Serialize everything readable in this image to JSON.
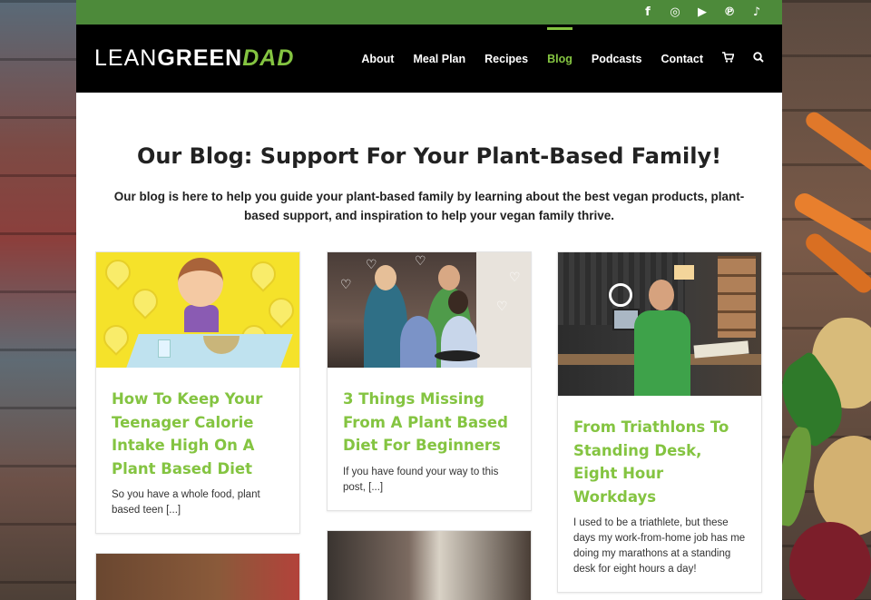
{
  "social": {
    "icons": [
      {
        "name": "facebook-icon",
        "glyph": "f"
      },
      {
        "name": "instagram-icon",
        "glyph": "◎"
      },
      {
        "name": "youtube-icon",
        "glyph": "▶"
      },
      {
        "name": "pinterest-icon",
        "glyph": "℗"
      },
      {
        "name": "tiktok-icon",
        "glyph": "♪"
      }
    ]
  },
  "logo": {
    "part1": "LEAN",
    "part2": "GREEN",
    "part3": "DAD"
  },
  "nav": {
    "items": [
      "About",
      "Meal Plan",
      "Recipes",
      "Blog",
      "Podcasts",
      "Contact"
    ],
    "active": "Blog",
    "cart_icon": "cart-icon",
    "search_icon": "search-icon"
  },
  "page": {
    "title": "Our Blog: Support For Your Plant-Based Family!",
    "intro": "Our blog is here to help you guide your plant-based family by learning about the best vegan products, plant-based support, and inspiration to help your vegan family thrive."
  },
  "posts": [
    {
      "title": "How To Keep Your Teenager Calorie Intake High On A Plant Based Diet",
      "excerpt": "So you have a whole food, plant based teen [...]"
    },
    {
      "title": "3 Things Missing From A Plant Based Diet For Beginners",
      "excerpt": "If you have found your way to this post, [...]"
    },
    {
      "title": "From Triathlons To Standing Desk, Eight Hour Workdays",
      "excerpt": "I used to be a triathlete, but these days my work-from-home job has me doing my marathons at a standing desk for eight hours a day!"
    }
  ],
  "colors": {
    "accent_green": "#84c441",
    "topbar_green": "#4d8a3a",
    "header_black": "#000000"
  }
}
